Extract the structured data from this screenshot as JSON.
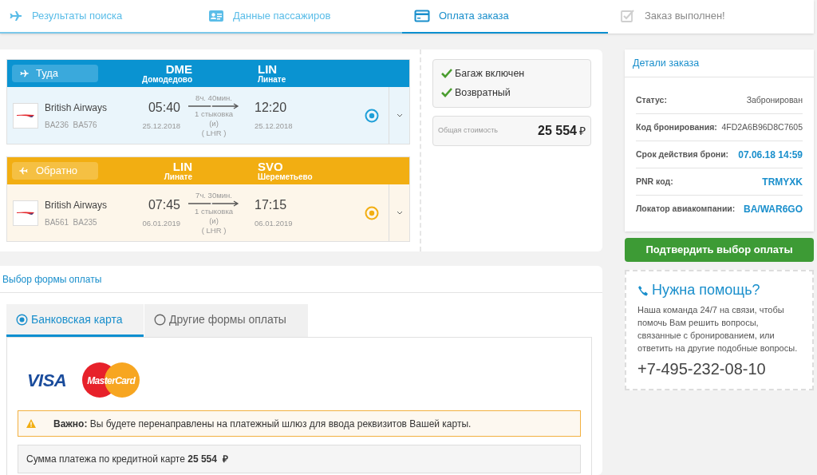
{
  "steps": [
    {
      "label": "Результаты поиска",
      "completed": true,
      "selected": false
    },
    {
      "label": "Данные пассажиров",
      "completed": true,
      "selected": false
    },
    {
      "label": "Оплата заказа",
      "completed": false,
      "selected": true
    },
    {
      "label": "Заказ выполнен!",
      "completed": false,
      "selected": false
    }
  ],
  "legs": [
    {
      "kind": "outbound",
      "direction": "Туда",
      "from_code": "DME",
      "from_name": "Домодедово",
      "to_code": "LIN",
      "to_name": "Линате",
      "airline": "British Airways",
      "flights": "BA236  BA576",
      "dep_time": "05:40",
      "dep_date": "25.12.2018",
      "duration": "8ч. 40мин.",
      "stops": "1 стыковка",
      "stop_sep": "(и)",
      "stop_airport": "( LHR )",
      "arr_time": "12:20",
      "arr_date": "25.12.2018",
      "selected": true
    },
    {
      "kind": "return",
      "direction": "Обратно",
      "from_code": "LIN",
      "from_name": "Линате",
      "to_code": "SVO",
      "to_name": "Шереметьево",
      "airline": "British Airways",
      "flights": "BA561  BA235",
      "dep_time": "07:45",
      "dep_date": "06.01.2019",
      "duration": "7ч. 30мин.",
      "stops": "1 стыковка",
      "stop_sep": "(и)",
      "stop_airport": "( LHR )",
      "arr_time": "17:15",
      "arr_date": "06.01.2019",
      "selected": true
    }
  ],
  "features": [
    {
      "label": "Багаж включен",
      "checked": true
    },
    {
      "label": "Возвратный",
      "checked": true
    }
  ],
  "total": {
    "label": "Общая стоимость",
    "amount": "25 554",
    "currency": "₽"
  },
  "order_details": {
    "title": "Детали заказа",
    "rows": [
      {
        "label": "Статус:",
        "value": "Забронирован",
        "highlight": false
      },
      {
        "label": "Код бронирования:",
        "value": "4FD2A6B96D8C7605",
        "highlight": false
      },
      {
        "label": "Срок действия брони:",
        "value": "07.06.18 14:59",
        "highlight": true
      },
      {
        "label": "PNR код:",
        "value": "TRMYXK",
        "highlight": true
      },
      {
        "label": "Локатор авиакомпании:",
        "value": "BA/WAR6GO",
        "highlight": true
      }
    ]
  },
  "confirm_button": "Подтвердить выбор оплаты",
  "help": {
    "title": "Нужна помощь?",
    "text": "Наша команда 24/7 на связи, чтобы помочь Вам решить вопросы, связанные с бронированием, или ответить на другие подобные вопросы.",
    "phone": "+7-495-232-08-10"
  },
  "payment": {
    "title": "Выбор формы оплаты",
    "tabs": [
      {
        "label": "Банковская карта",
        "selected": true
      },
      {
        "label": "Другие формы оплаты",
        "selected": false
      }
    ],
    "card_logos": [
      "VISA",
      "MasterCard"
    ],
    "notice": "**Важно:** Вы будете перенаправлены на платежный шлюз для ввода реквизитов Вашей карты.",
    "sum": "Сумма платежа по кредитной карте **25 554  ₽**"
  }
}
